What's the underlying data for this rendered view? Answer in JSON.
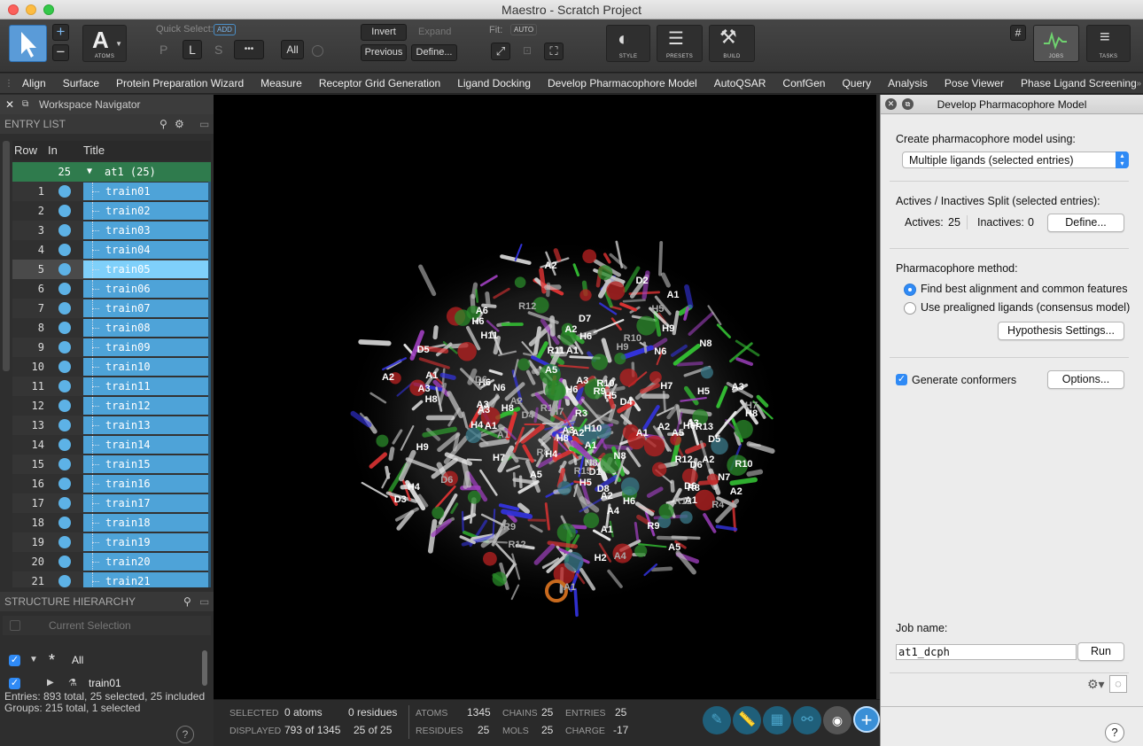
{
  "window": {
    "title": "Maestro - Scratch Project"
  },
  "toolbar": {
    "atoms_label": "ATOMS",
    "quick_select_label": "Quick Select:",
    "add_badge": "ADD",
    "p_btn": "P",
    "l_btn": "L",
    "s_btn": "S",
    "more_btn": "•••",
    "all_btn": "All",
    "invert": "Invert",
    "expand": "Expand",
    "previous": "Previous",
    "define": "Define...",
    "fit_label": "Fit:",
    "auto_badge": "AUTO",
    "style": "STYLE",
    "presets": "PRESETS",
    "build": "BUILD",
    "jobs": "JOBS",
    "tasks": "TASKS"
  },
  "menu": [
    "Align",
    "Surface",
    "Protein Preparation Wizard",
    "Measure",
    "Receptor Grid Generation",
    "Ligand Docking",
    "Develop Pharmacophore Model",
    "AutoQSAR",
    "ConfGen",
    "Query",
    "Analysis",
    "Pose Viewer",
    "Phase Ligand Screening"
  ],
  "navigator": {
    "title": "Workspace Navigator",
    "entry_list": "ENTRY LIST",
    "col_row": "Row",
    "col_in": "In",
    "col_title": "Title",
    "group_count": "25",
    "group_title": "at1 (25)",
    "rows": [
      {
        "n": "1",
        "t": "train01"
      },
      {
        "n": "2",
        "t": "train02"
      },
      {
        "n": "3",
        "t": "train03"
      },
      {
        "n": "4",
        "t": "train04"
      },
      {
        "n": "5",
        "t": "train05"
      },
      {
        "n": "6",
        "t": "train06"
      },
      {
        "n": "7",
        "t": "train07"
      },
      {
        "n": "8",
        "t": "train08"
      },
      {
        "n": "9",
        "t": "train09"
      },
      {
        "n": "10",
        "t": "train10"
      },
      {
        "n": "11",
        "t": "train11"
      },
      {
        "n": "12",
        "t": "train12"
      },
      {
        "n": "13",
        "t": "train13"
      },
      {
        "n": "14",
        "t": "train14"
      },
      {
        "n": "15",
        "t": "train15"
      },
      {
        "n": "16",
        "t": "train16"
      },
      {
        "n": "17",
        "t": "train17"
      },
      {
        "n": "18",
        "t": "train18"
      },
      {
        "n": "19",
        "t": "train19"
      },
      {
        "n": "20",
        "t": "train20"
      },
      {
        "n": "21",
        "t": "train21"
      }
    ],
    "highlighted_row": "5",
    "structure_hierarchy": "STRUCTURE HIERARCHY",
    "current_selection": "Current Selection",
    "tree_all": "All",
    "tree_child": "train01",
    "entries_summary": "Entries: 893 total, 25 selected, 25 included",
    "groups_summary": "Groups: 215 total, 1 selected"
  },
  "status": {
    "selected_label": "SELECTED",
    "selected_atoms": "0 atoms",
    "selected_residues": "0 residues",
    "displayed_label": "DISPLAYED",
    "displayed_atoms": "793 of 1345",
    "displayed_residues": "25 of 25",
    "atoms_label": "ATOMS",
    "atoms": "1345",
    "chains_label": "CHAINS",
    "chains": "25",
    "entries_label": "ENTRIES",
    "entries": "25",
    "residues_label": "RESIDUES",
    "residues": "25",
    "mols_label": "MOLS",
    "mols": "25",
    "charge_label": "CHARGE",
    "charge": "-17"
  },
  "panel": {
    "title": "Develop Pharmacophore Model",
    "create_label": "Create pharmacophore model using:",
    "create_value": "Multiple ligands (selected entries)",
    "split_label": "Actives / Inactives Split (selected entries):",
    "actives_label": "Actives:",
    "actives": "25",
    "inactives_label": "Inactives:",
    "inactives": "0",
    "define_btn": "Define...",
    "method_label": "Pharmacophore method:",
    "method_opt1": "Find best alignment and common features",
    "method_opt2": "Use prealigned ligands (consensus model)",
    "hypothesis_btn": "Hypothesis Settings...",
    "generate_label": "Generate conformers",
    "options_btn": "Options...",
    "jobname_label": "Job name:",
    "jobname_value": "at1_dcph",
    "run_btn": "Run",
    "help": "?"
  },
  "atom_labels": [
    "H9",
    "H6",
    "N6",
    "D4",
    "A2",
    "N8",
    "H5",
    "D6",
    "A4",
    "H7",
    "H5",
    "A1",
    "H9",
    "R8",
    "H4",
    "H5",
    "R12",
    "A5",
    "H7",
    "R13",
    "D5",
    "R10",
    "R8",
    "H10",
    "A1",
    "H9",
    "A6",
    "H6",
    "H2",
    "A3",
    "D7",
    "A2",
    "H11",
    "R8",
    "D1",
    "A1",
    "R12",
    "A1",
    "A3",
    "A5",
    "D6",
    "N8",
    "A3",
    "R10",
    "A2",
    "A1",
    "A1",
    "R10",
    "R12",
    "H8",
    "R12",
    "R10",
    "D4",
    "A2",
    "A3",
    "A2",
    "H6",
    "D3",
    "D8",
    "D6",
    "N6",
    "R4",
    "R9",
    "A2",
    "R11",
    "A5",
    "A2",
    "H4",
    "D2",
    "A3",
    "A2",
    "N8",
    "H8",
    "A1",
    "R15",
    "A1",
    "H8",
    "A1",
    "H5",
    "H6",
    "A3",
    "H6",
    "R3",
    "A2",
    "R9",
    "D6",
    "H6",
    "A1",
    "N7",
    "H8",
    "A3",
    "H4",
    "H7",
    "D5",
    "A4",
    "R9",
    "H7",
    "A5",
    "A2"
  ]
}
